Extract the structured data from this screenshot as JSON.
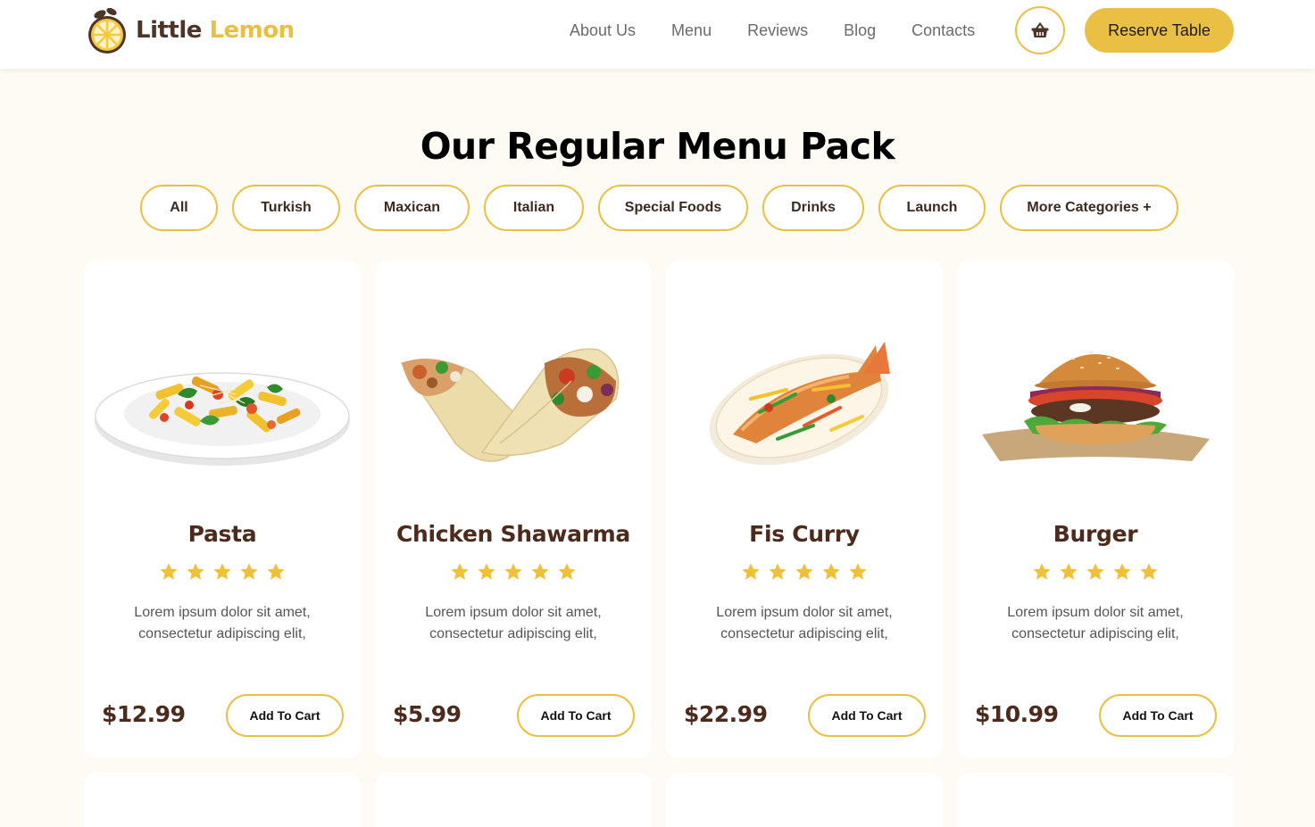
{
  "brand": {
    "word1": "Little",
    "word2": "Lemon"
  },
  "nav": [
    "About Us",
    "Menu",
    "Reviews",
    "Blog",
    "Contacts"
  ],
  "header": {
    "cart_icon": "basket-icon",
    "reserve_label": "Reserve Table"
  },
  "section": {
    "title": "Our Regular Menu Pack"
  },
  "categories": [
    "All",
    "Turkish",
    "Maxican",
    "Italian",
    "Special Foods",
    "Drinks",
    "Launch",
    "More Categories +"
  ],
  "menu_items": [
    {
      "name": "Pasta",
      "rating": 5,
      "description": "Lorem ipsum dolor sit amet, consectetur adipiscing elit,",
      "price": "$12.99",
      "button": "Add To Cart",
      "image": "pasta-image"
    },
    {
      "name": "Chicken Shawarma",
      "rating": 5,
      "description": "Lorem ipsum dolor sit amet, consectetur adipiscing elit,",
      "price": "$5.99",
      "button": "Add To Cart",
      "image": "shawarma-image"
    },
    {
      "name": "Fis Curry",
      "rating": 5,
      "description": "Lorem ipsum dolor sit amet, consectetur adipiscing elit,",
      "price": "$22.99",
      "button": "Add To Cart",
      "image": "fish-curry-image"
    },
    {
      "name": "Burger",
      "rating": 5,
      "description": "Lorem ipsum dolor sit amet, consectetur adipiscing elit,",
      "price": "$10.99",
      "button": "Add To Cart",
      "image": "burger-image"
    }
  ],
  "colors": {
    "accent": "#e9c044",
    "brand_brown": "#4c2a1c",
    "background": "#fdfbf3"
  }
}
